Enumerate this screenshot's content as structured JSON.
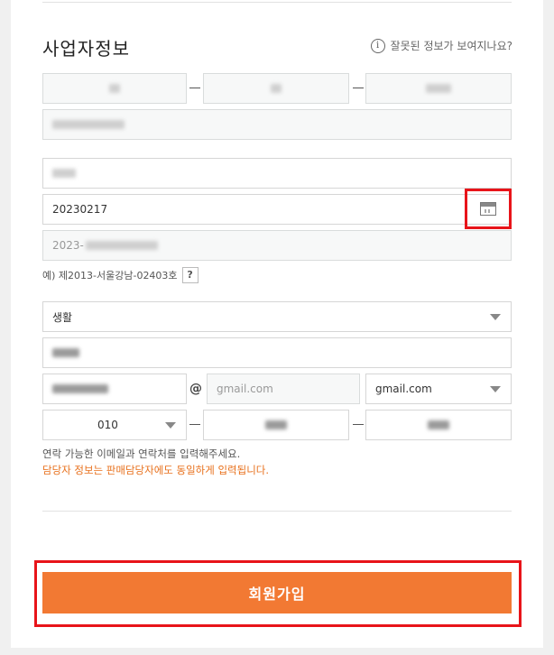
{
  "section": {
    "title": "사업자정보",
    "help_text": "잘못된 정보가 보여지나요?"
  },
  "business": {
    "birth_date_value": "20230217",
    "permit_number_value": "2023-",
    "example_text": "예) 제2013-서울강남-02403호",
    "help_mark": "?"
  },
  "contact": {
    "category_value": "생활",
    "email_domain_placeholder": "gmail.com",
    "email_domain_select": "gmail.com",
    "at_sign": "@",
    "phone_prefix": "010",
    "note": "연락 가능한 이메일과 연락처를 입력해주세요.",
    "warning": "담당자 정보는 판매담당자에도 동일하게 입력됩니다.",
    "warning_color": "#e8711d"
  },
  "actions": {
    "join_label": "회원가입",
    "join_color": "#f27933",
    "highlight_color": "#e8141a"
  },
  "icons": {
    "help": "info-circle-icon",
    "calendar": "calendar-icon",
    "dropdown": "chevron-down-icon"
  }
}
